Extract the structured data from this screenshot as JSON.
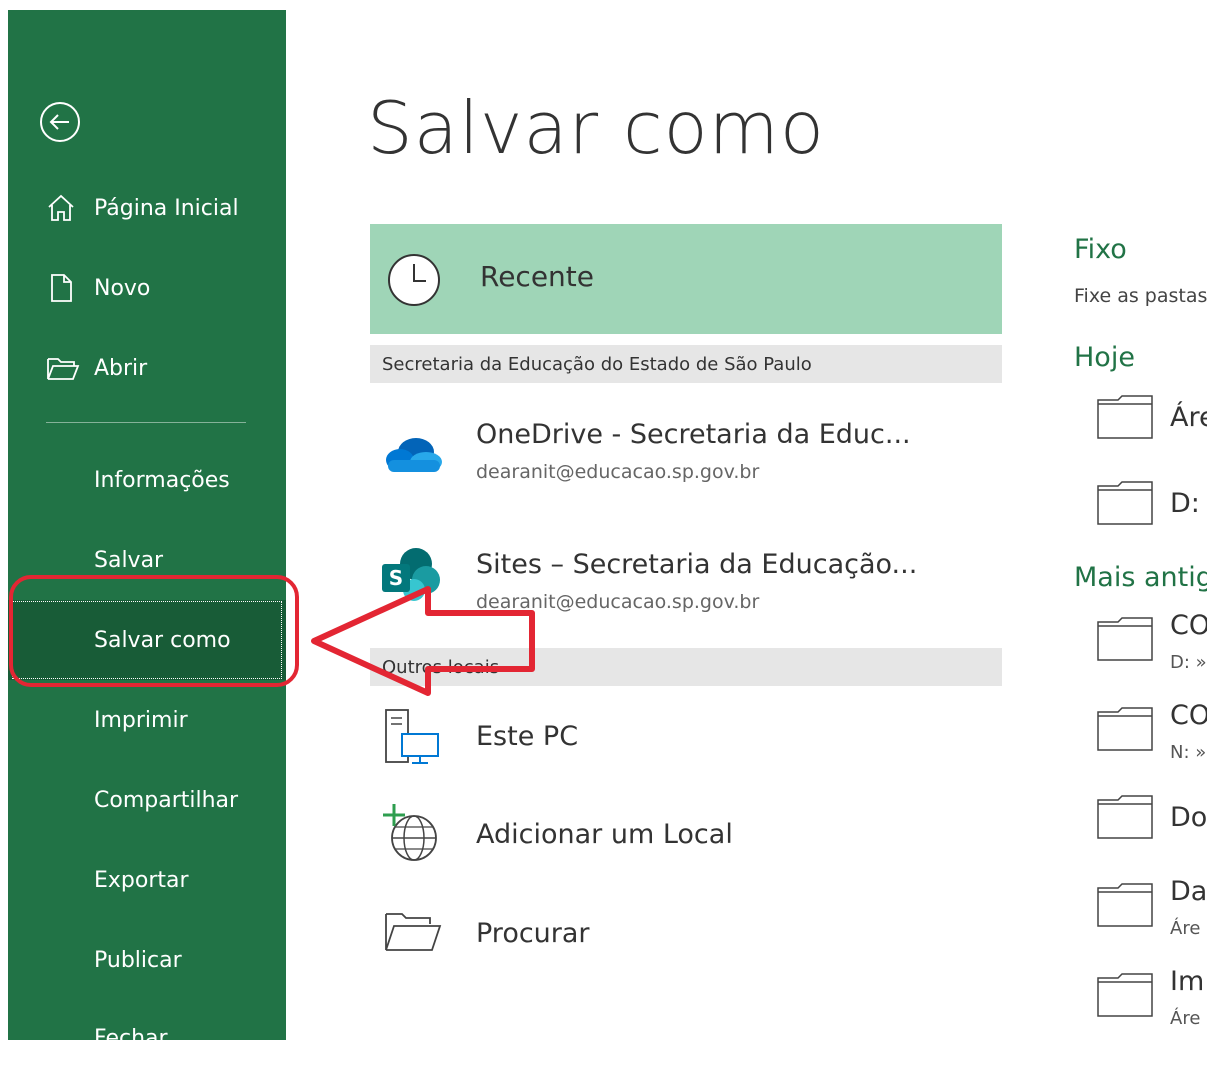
{
  "title": "Salvar como",
  "sidebar": {
    "items": [
      {
        "label": "Página Inicial"
      },
      {
        "label": "Novo"
      },
      {
        "label": "Abrir"
      },
      {
        "label": "Informações"
      },
      {
        "label": "Salvar"
      },
      {
        "label": "Salvar como"
      },
      {
        "label": "Imprimir"
      },
      {
        "label": "Compartilhar"
      },
      {
        "label": "Exportar"
      },
      {
        "label": "Publicar"
      },
      {
        "label": "Fechar"
      }
    ]
  },
  "locations": {
    "recent_label": "Recente",
    "org_section": "Secretaria da Educação do Estado de São Paulo",
    "onedrive": {
      "name": "OneDrive - Secretaria da Educ...",
      "account": "dearanit@educacao.sp.gov.br"
    },
    "sites": {
      "name": "Sites – Secretaria da Educação...",
      "account": "dearanit@educacao.sp.gov.br"
    },
    "other_section": "Outros locais",
    "this_pc": "Este PC",
    "add_location": "Adicionar um Local",
    "browse": "Procurar"
  },
  "right": {
    "pinned_header": "Fixo",
    "pinned_hint": "Fixe as pastas",
    "today_header": "Hoje",
    "today_items": [
      {
        "name": "Áre"
      },
      {
        "name": "D:"
      }
    ],
    "older_header": "Mais antig",
    "older_items": [
      {
        "name": "CO",
        "path": "D: »"
      },
      {
        "name": "CO",
        "path": "N: »"
      },
      {
        "name": "Do",
        "path": ""
      },
      {
        "name": "Da",
        "path": "Áre"
      },
      {
        "name": "Im",
        "path": "Áre"
      }
    ]
  },
  "colors": {
    "brand": "#217346",
    "active": "#185c37",
    "recent_bg": "#9fd5b7",
    "annotation": "#e32633"
  }
}
